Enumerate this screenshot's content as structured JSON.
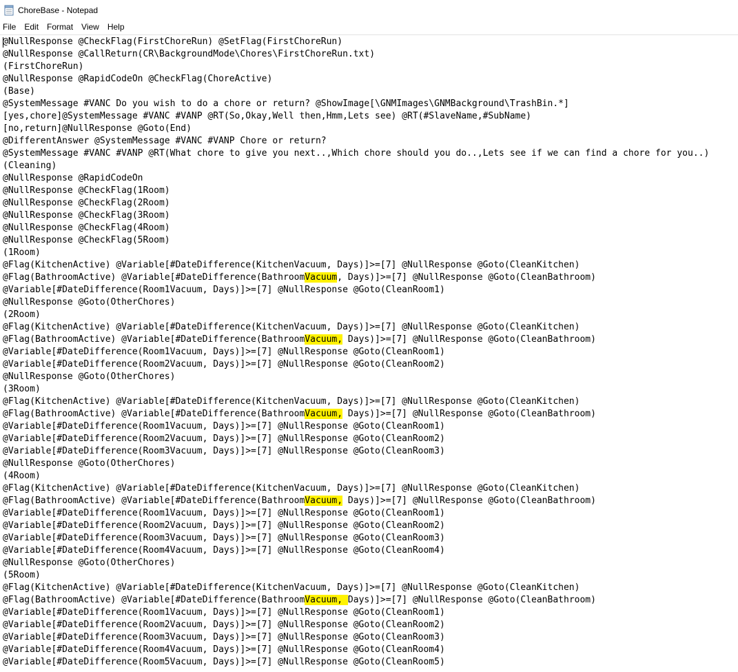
{
  "window": {
    "title": "ChoreBase - Notepad",
    "app_icon": "notepad-icon"
  },
  "menu": {
    "items": [
      "File",
      "Edit",
      "Format",
      "View",
      "Help"
    ]
  },
  "editor": {
    "highlight_color": "#fff200",
    "lines": [
      "@NullResponse @CheckFlag(FirstChoreRun) @SetFlag(FirstChoreRun)",
      "@NullResponse @CallReturn(CR\\BackgroundMode\\Chores\\FirstChoreRun.txt)",
      "(FirstChoreRun)",
      "@NullResponse @RapidCodeOn @CheckFlag(ChoreActive)",
      "(Base)",
      "@SystemMessage #VANC Do you wish to do a chore or return? @ShowImage[\\GNMImages\\GNMBackground\\TrashBin.*]",
      "[yes,chore]@SystemMessage #VANC #VANP @RT(So,Okay,Well then,Hmm,Lets see) @RT(#SlaveName,#SubName)",
      "[no,return]@NullResponse @Goto(End)",
      "@DifferentAnswer @SystemMessage #VANC #VANP Chore or return?",
      "@SystemMessage #VANC #VANP @RT(What chore to give you next..,Which chore should you do..,Lets see if we can find a chore for you..)",
      "(Cleaning)",
      "@NullResponse @RapidCodeOn",
      "@NullResponse @CheckFlag(1Room)",
      "@NullResponse @CheckFlag(2Room)",
      "@NullResponse @CheckFlag(3Room)",
      "@NullResponse @CheckFlag(4Room)",
      "@NullResponse @CheckFlag(5Room)",
      "(1Room)",
      "@Flag(KitchenActive) @Variable[#DateDifference(KitchenVacuum, Days)]>=[7] @NullResponse @Goto(CleanKitchen)",
      "@Flag(BathroomActive) @Variable[#DateDifference(BathroomVacuum, Days)]>=[7] @NullResponse @Goto(CleanBathroom)",
      "@Variable[#DateDifference(Room1Vacuum, Days)]>=[7] @NullResponse @Goto(CleanRoom1)",
      "@NullResponse @Goto(OtherChores)",
      "(2Room)",
      "@Flag(KitchenActive) @Variable[#DateDifference(KitchenVacuum, Days)]>=[7] @NullResponse @Goto(CleanKitchen)",
      "@Flag(BathroomActive) @Variable[#DateDifference(BathroomVacuum, Days)]>=[7] @NullResponse @Goto(CleanBathroom)",
      "@Variable[#DateDifference(Room1Vacuum, Days)]>=[7] @NullResponse @Goto(CleanRoom1)",
      "@Variable[#DateDifference(Room2Vacuum, Days)]>=[7] @NullResponse @Goto(CleanRoom2)",
      "@NullResponse @Goto(OtherChores)",
      "(3Room)",
      "@Flag(KitchenActive) @Variable[#DateDifference(KitchenVacuum, Days)]>=[7] @NullResponse @Goto(CleanKitchen)",
      "@Flag(BathroomActive) @Variable[#DateDifference(BathroomVacuum, Days)]>=[7] @NullResponse @Goto(CleanBathroom)",
      "@Variable[#DateDifference(Room1Vacuum, Days)]>=[7] @NullResponse @Goto(CleanRoom1)",
      "@Variable[#DateDifference(Room2Vacuum, Days)]>=[7] @NullResponse @Goto(CleanRoom2)",
      "@Variable[#DateDifference(Room3Vacuum, Days)]>=[7] @NullResponse @Goto(CleanRoom3)",
      "@NullResponse @Goto(OtherChores)",
      "(4Room)",
      "@Flag(KitchenActive) @Variable[#DateDifference(KitchenVacuum, Days)]>=[7] @NullResponse @Goto(CleanKitchen)",
      "@Flag(BathroomActive) @Variable[#DateDifference(BathroomVacuum, Days)]>=[7] @NullResponse @Goto(CleanBathroom)",
      "@Variable[#DateDifference(Room1Vacuum, Days)]>=[7] @NullResponse @Goto(CleanRoom1)",
      "@Variable[#DateDifference(Room2Vacuum, Days)]>=[7] @NullResponse @Goto(CleanRoom2)",
      "@Variable[#DateDifference(Room3Vacuum, Days)]>=[7] @NullResponse @Goto(CleanRoom3)",
      "@Variable[#DateDifference(Room4Vacuum, Days)]>=[7] @NullResponse @Goto(CleanRoom4)",
      "@NullResponse @Goto(OtherChores)",
      "(5Room)",
      "@Flag(KitchenActive) @Variable[#DateDifference(KitchenVacuum, Days)]>=[7] @NullResponse @Goto(CleanKitchen)",
      "@Flag(BathroomActive) @Variable[#DateDifference(BathroomVacuum, Days)]>=[7] @NullResponse @Goto(CleanBathroom)",
      "@Variable[#DateDifference(Room1Vacuum, Days)]>=[7] @NullResponse @Goto(CleanRoom1)",
      "@Variable[#DateDifference(Room2Vacuum, Days)]>=[7] @NullResponse @Goto(CleanRoom2)",
      "@Variable[#DateDifference(Room3Vacuum, Days)]>=[7] @NullResponse @Goto(CleanRoom3)",
      "@Variable[#DateDifference(Room4Vacuum, Days)]>=[7] @NullResponse @Goto(CleanRoom4)",
      "@Variable[#DateDifference(Room5Vacuum, Days)]>=[7] @NullResponse @Goto(CleanRoom5)"
    ],
    "highlighted_lines": [
      {
        "line": 19,
        "text": "Vacuum"
      },
      {
        "line": 24,
        "text": "Vacuum,"
      },
      {
        "line": 30,
        "text": "Vacuum,"
      },
      {
        "line": 37,
        "text": "Vacuum,"
      },
      {
        "line": 45,
        "text": "Vacuum, "
      }
    ]
  }
}
